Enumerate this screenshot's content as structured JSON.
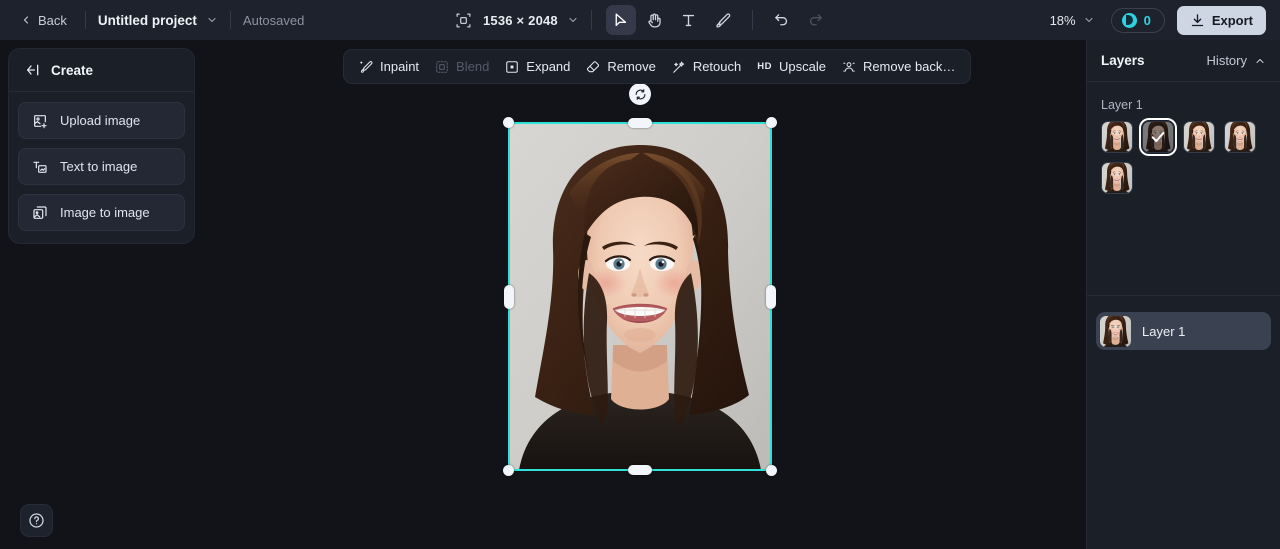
{
  "header": {
    "back_label": "Back",
    "project_name": "Untitled project",
    "autosave_label": "Autosaved",
    "canvas_size": "1536 × 2048",
    "zoom_level": "18%",
    "credits_count": "0",
    "export_label": "Export",
    "icons": {
      "back_chevron": "chevron-left-icon",
      "project_chevron": "chevron-down-icon",
      "canvas_size_icon": "canvas-size-icon",
      "size_chevron": "chevron-down-icon",
      "zoom_chevron": "chevron-down-icon",
      "credit_icon": "credit-coin-icon",
      "export_icon": "download-icon"
    },
    "tools": [
      {
        "name": "select-tool",
        "label": "Select",
        "active": true,
        "disabled": false
      },
      {
        "name": "hand-tool",
        "label": "Hand",
        "active": false,
        "disabled": false
      },
      {
        "name": "text-tool",
        "label": "Text",
        "active": false,
        "disabled": false
      },
      {
        "name": "brush-tool",
        "label": "Brush",
        "active": false,
        "disabled": false
      },
      {
        "name": "undo-tool",
        "label": "Undo",
        "active": false,
        "disabled": false
      },
      {
        "name": "redo-tool",
        "label": "Redo",
        "active": false,
        "disabled": true
      }
    ]
  },
  "left_panel": {
    "title": "Create",
    "collapse_icon": "collapse-panel-icon",
    "items": [
      {
        "label": "Upload image",
        "icon": "upload-image-icon"
      },
      {
        "label": "Text to image",
        "icon": "text-to-image-icon"
      },
      {
        "label": "Image to image",
        "icon": "image-to-image-icon"
      }
    ]
  },
  "edit_toolbar": {
    "items": [
      {
        "label": "Inpaint",
        "icon": "inpaint-brush-icon",
        "disabled": false
      },
      {
        "label": "Blend",
        "icon": "blend-icon",
        "disabled": true
      },
      {
        "label": "Expand",
        "icon": "expand-icon",
        "disabled": false
      },
      {
        "label": "Remove",
        "icon": "eraser-icon",
        "disabled": false
      },
      {
        "label": "Retouch",
        "icon": "retouch-wand-icon",
        "disabled": false
      },
      {
        "label": "Upscale",
        "icon": "hd-icon",
        "badge": "HD",
        "disabled": false
      },
      {
        "label": "Remove back…",
        "icon": "remove-background-icon",
        "disabled": false
      }
    ]
  },
  "canvas": {
    "selection": {
      "rotate_icon": "rotate-icon"
    },
    "image_alt": "portrait-photo"
  },
  "help": {
    "icon": "help-circle-icon",
    "label": "Help"
  },
  "right_panel": {
    "title": "Layers",
    "history_label": "History",
    "history_icon": "chevron-up-icon",
    "layer_group_label": "Layer 1",
    "thumbnails": [
      {
        "name": "variant-1",
        "selected": false
      },
      {
        "name": "variant-2",
        "selected": true
      },
      {
        "name": "variant-3",
        "selected": false
      },
      {
        "name": "variant-4",
        "selected": false
      },
      {
        "name": "variant-5",
        "selected": false
      }
    ],
    "layers": [
      {
        "name": "Layer 1"
      }
    ]
  },
  "colors": {
    "accent_teal": "#2ad3e0",
    "selection_border": "#2ee0d6",
    "header_bg": "#1e222c",
    "panel_bg": "#1b1f28",
    "canvas_bg": "#111319",
    "export_bg": "#ced6e3"
  }
}
